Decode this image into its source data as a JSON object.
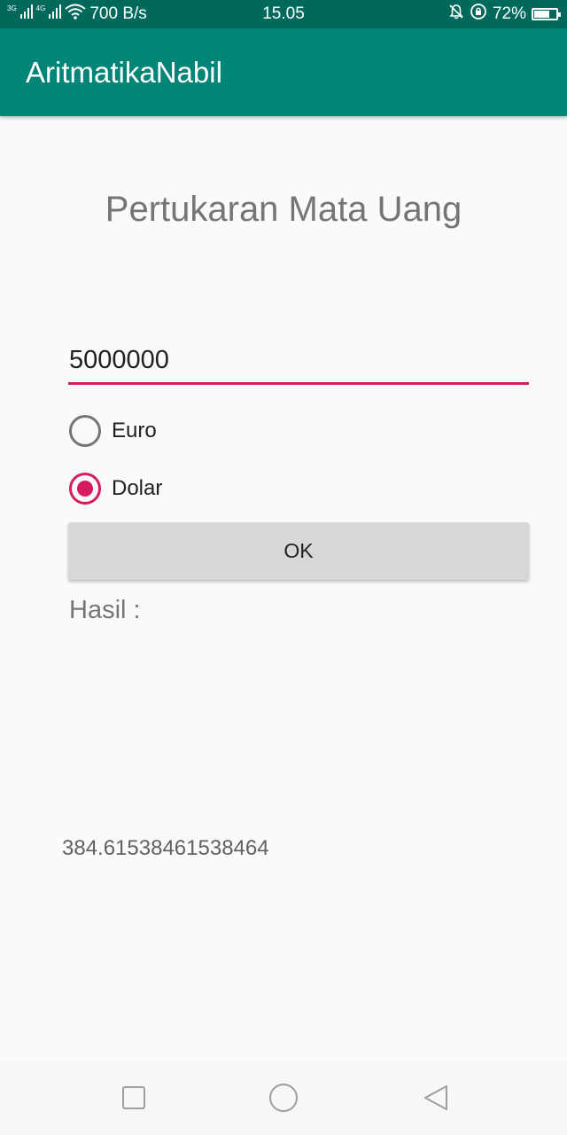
{
  "status_bar": {
    "network_type_1": "3G",
    "network_type_2": "4G",
    "speed": "700 B/s",
    "time": "15.05",
    "battery_level": "72%",
    "battery_fraction": 0.72,
    "icons": [
      "signal-icon",
      "signal-icon",
      "wifi-icon",
      "bell-muted-icon",
      "rotation-lock-icon",
      "battery-icon"
    ]
  },
  "app_bar": {
    "title": "AritmatikaNabil"
  },
  "form": {
    "heading": "Pertukaran Mata Uang",
    "amount_value": "5000000",
    "options": [
      {
        "label": "Euro",
        "checked": false
      },
      {
        "label": "Dolar",
        "checked": true
      }
    ],
    "ok_label": "OK",
    "result_label": "Hasil :",
    "result_value": "384.61538461538464"
  },
  "nav_bar": {
    "icons": [
      "recents-icon",
      "home-icon",
      "back-icon"
    ]
  },
  "colors": {
    "status_bar": "#00695c",
    "primary": "#008577",
    "accent": "#d81b60"
  }
}
